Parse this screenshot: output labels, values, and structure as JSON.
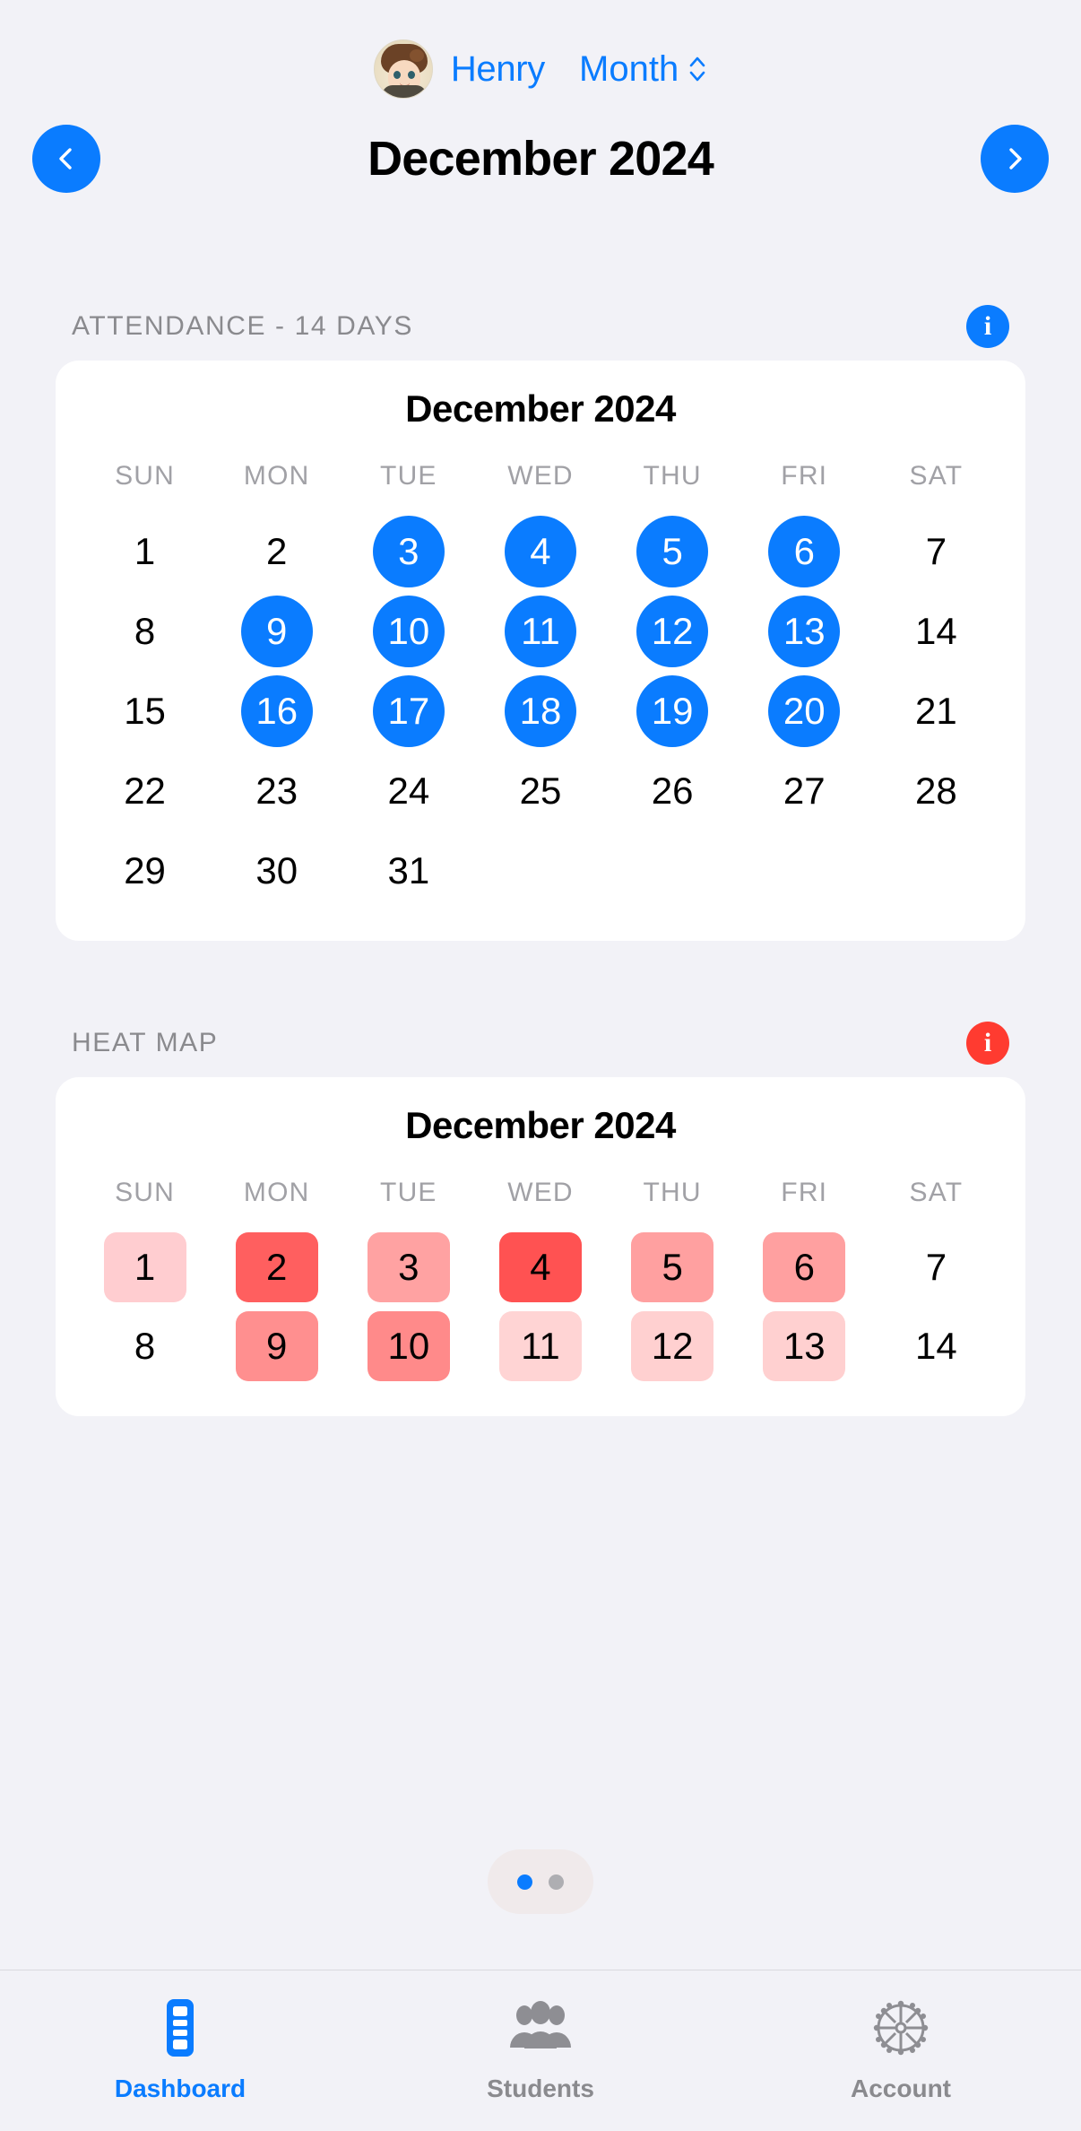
{
  "header": {
    "user_name": "Henry",
    "avatar_name": "boy-avatar",
    "period_selector": "Month"
  },
  "month_nav": {
    "prev_label": "Previous month",
    "next_label": "Next month",
    "title": "December 2024"
  },
  "attendance": {
    "section_title": "ATTENDANCE - 14 DAYS",
    "info_label": "i",
    "card_title": "December 2024",
    "weekdays": [
      "SUN",
      "MON",
      "TUE",
      "WED",
      "THU",
      "FRI",
      "SAT"
    ],
    "days": [
      {
        "n": "1",
        "on": false
      },
      {
        "n": "2",
        "on": false
      },
      {
        "n": "3",
        "on": true
      },
      {
        "n": "4",
        "on": true
      },
      {
        "n": "5",
        "on": true
      },
      {
        "n": "6",
        "on": true
      },
      {
        "n": "7",
        "on": false
      },
      {
        "n": "8",
        "on": false
      },
      {
        "n": "9",
        "on": true
      },
      {
        "n": "10",
        "on": true
      },
      {
        "n": "11",
        "on": true
      },
      {
        "n": "12",
        "on": true
      },
      {
        "n": "13",
        "on": true
      },
      {
        "n": "14",
        "on": false
      },
      {
        "n": "15",
        "on": false
      },
      {
        "n": "16",
        "on": true
      },
      {
        "n": "17",
        "on": true
      },
      {
        "n": "18",
        "on": true
      },
      {
        "n": "19",
        "on": true
      },
      {
        "n": "20",
        "on": true
      },
      {
        "n": "21",
        "on": false
      },
      {
        "n": "22",
        "on": false
      },
      {
        "n": "23",
        "on": false
      },
      {
        "n": "24",
        "on": false
      },
      {
        "n": "25",
        "on": false
      },
      {
        "n": "26",
        "on": false
      },
      {
        "n": "27",
        "on": false
      },
      {
        "n": "28",
        "on": false
      },
      {
        "n": "29",
        "on": false
      },
      {
        "n": "30",
        "on": false
      },
      {
        "n": "31",
        "on": false
      },
      {
        "n": "",
        "on": false
      },
      {
        "n": "",
        "on": false
      },
      {
        "n": "",
        "on": false
      },
      {
        "n": "",
        "on": false
      }
    ]
  },
  "heatmap": {
    "section_title": "HEAT MAP",
    "info_label": "i",
    "card_title": "December 2024",
    "weekdays": [
      "SUN",
      "MON",
      "TUE",
      "WED",
      "THU",
      "FRI",
      "SAT"
    ],
    "days": [
      {
        "n": "1",
        "color": "#ffcdd0"
      },
      {
        "n": "2",
        "color": "#ff5f5f"
      },
      {
        "n": "3",
        "color": "#ffa2a2"
      },
      {
        "n": "4",
        "color": "#ff5252"
      },
      {
        "n": "5",
        "color": "#ffa0a0"
      },
      {
        "n": "6",
        "color": "#ffa0a0"
      },
      {
        "n": "7",
        "color": "transparent"
      },
      {
        "n": "8",
        "color": "transparent"
      },
      {
        "n": "9",
        "color": "#ff8f8f"
      },
      {
        "n": "10",
        "color": "#ff8a8a"
      },
      {
        "n": "11",
        "color": "#ffd4d4"
      },
      {
        "n": "12",
        "color": "#ffd0d0"
      },
      {
        "n": "13",
        "color": "#ffd0d0"
      },
      {
        "n": "14",
        "color": "transparent"
      }
    ]
  },
  "page_indicator": {
    "total": 2,
    "active_index": 0
  },
  "tabbar": {
    "items": [
      {
        "label": "Dashboard",
        "icon": "dashboard-icon",
        "active": true
      },
      {
        "label": "Students",
        "icon": "people-icon",
        "active": false
      },
      {
        "label": "Account",
        "icon": "gear-icon",
        "active": false
      }
    ]
  },
  "colors": {
    "accent_blue": "#0a7cff",
    "info_red": "#ff3b30",
    "background": "#f2f2f7",
    "card": "#ffffff",
    "muted_text": "#8a8a8e"
  }
}
